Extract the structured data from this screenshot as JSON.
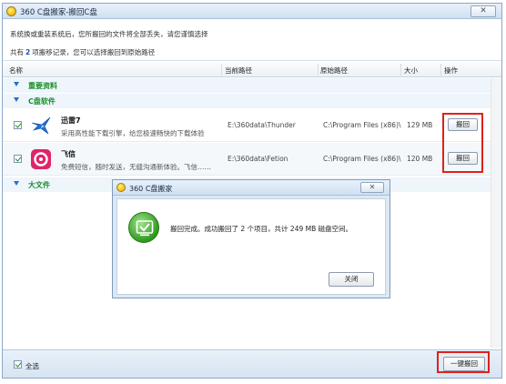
{
  "window": {
    "title": "360 C盘搬家-搬回C盘",
    "close_label": "✕"
  },
  "info": {
    "line1": "系统换或重装系统后，您所搬回的文件将全部丢失，请您谨慎选择",
    "line2_prefix": "共有",
    "line2_count": "2",
    "line2_suffix": "项搬移记录，您可以选择搬回到原始路径"
  },
  "table": {
    "headers": {
      "name": "名称",
      "current_path": "当前路径",
      "original_path": "原始路径",
      "size": "大小",
      "action": "操作"
    },
    "groups": {
      "important": "重要资料",
      "csoftware": "C盘软件",
      "bigfile": "大文件"
    },
    "rows": [
      {
        "name": "迅雷7",
        "desc": "采用高性能下载引擎，给您极速畅快的下载体验",
        "current_path": "E:\\360data\\Thunder",
        "original_path": "C:\\Program Files (x86)\\",
        "size": "129 MB",
        "action": "搬回"
      },
      {
        "name": "飞信",
        "desc": "免费短信，随时发送，无缝沟通新体验。飞信……",
        "current_path": "E:\\360data\\Fetion",
        "original_path": "C:\\Program Files (x86)\\",
        "size": "120 MB",
        "action": "搬回"
      }
    ]
  },
  "footer": {
    "select_all": "全选",
    "one_click": "一键搬回"
  },
  "dialog": {
    "title": "360 C盘搬家",
    "close_label": "✕",
    "message": "搬回完成。成功搬回了 2 个项目，共计 249 MB 磁盘空间。",
    "ok_label": "关闭"
  },
  "colors": {
    "group_label": "#1a8f2a",
    "highlight": "#e0201b",
    "accent": "#2a6fc4"
  },
  "icons": {
    "thunder": "thunder-bird-icon",
    "fetion": "fetion-icon",
    "success": "success-check-icon"
  }
}
